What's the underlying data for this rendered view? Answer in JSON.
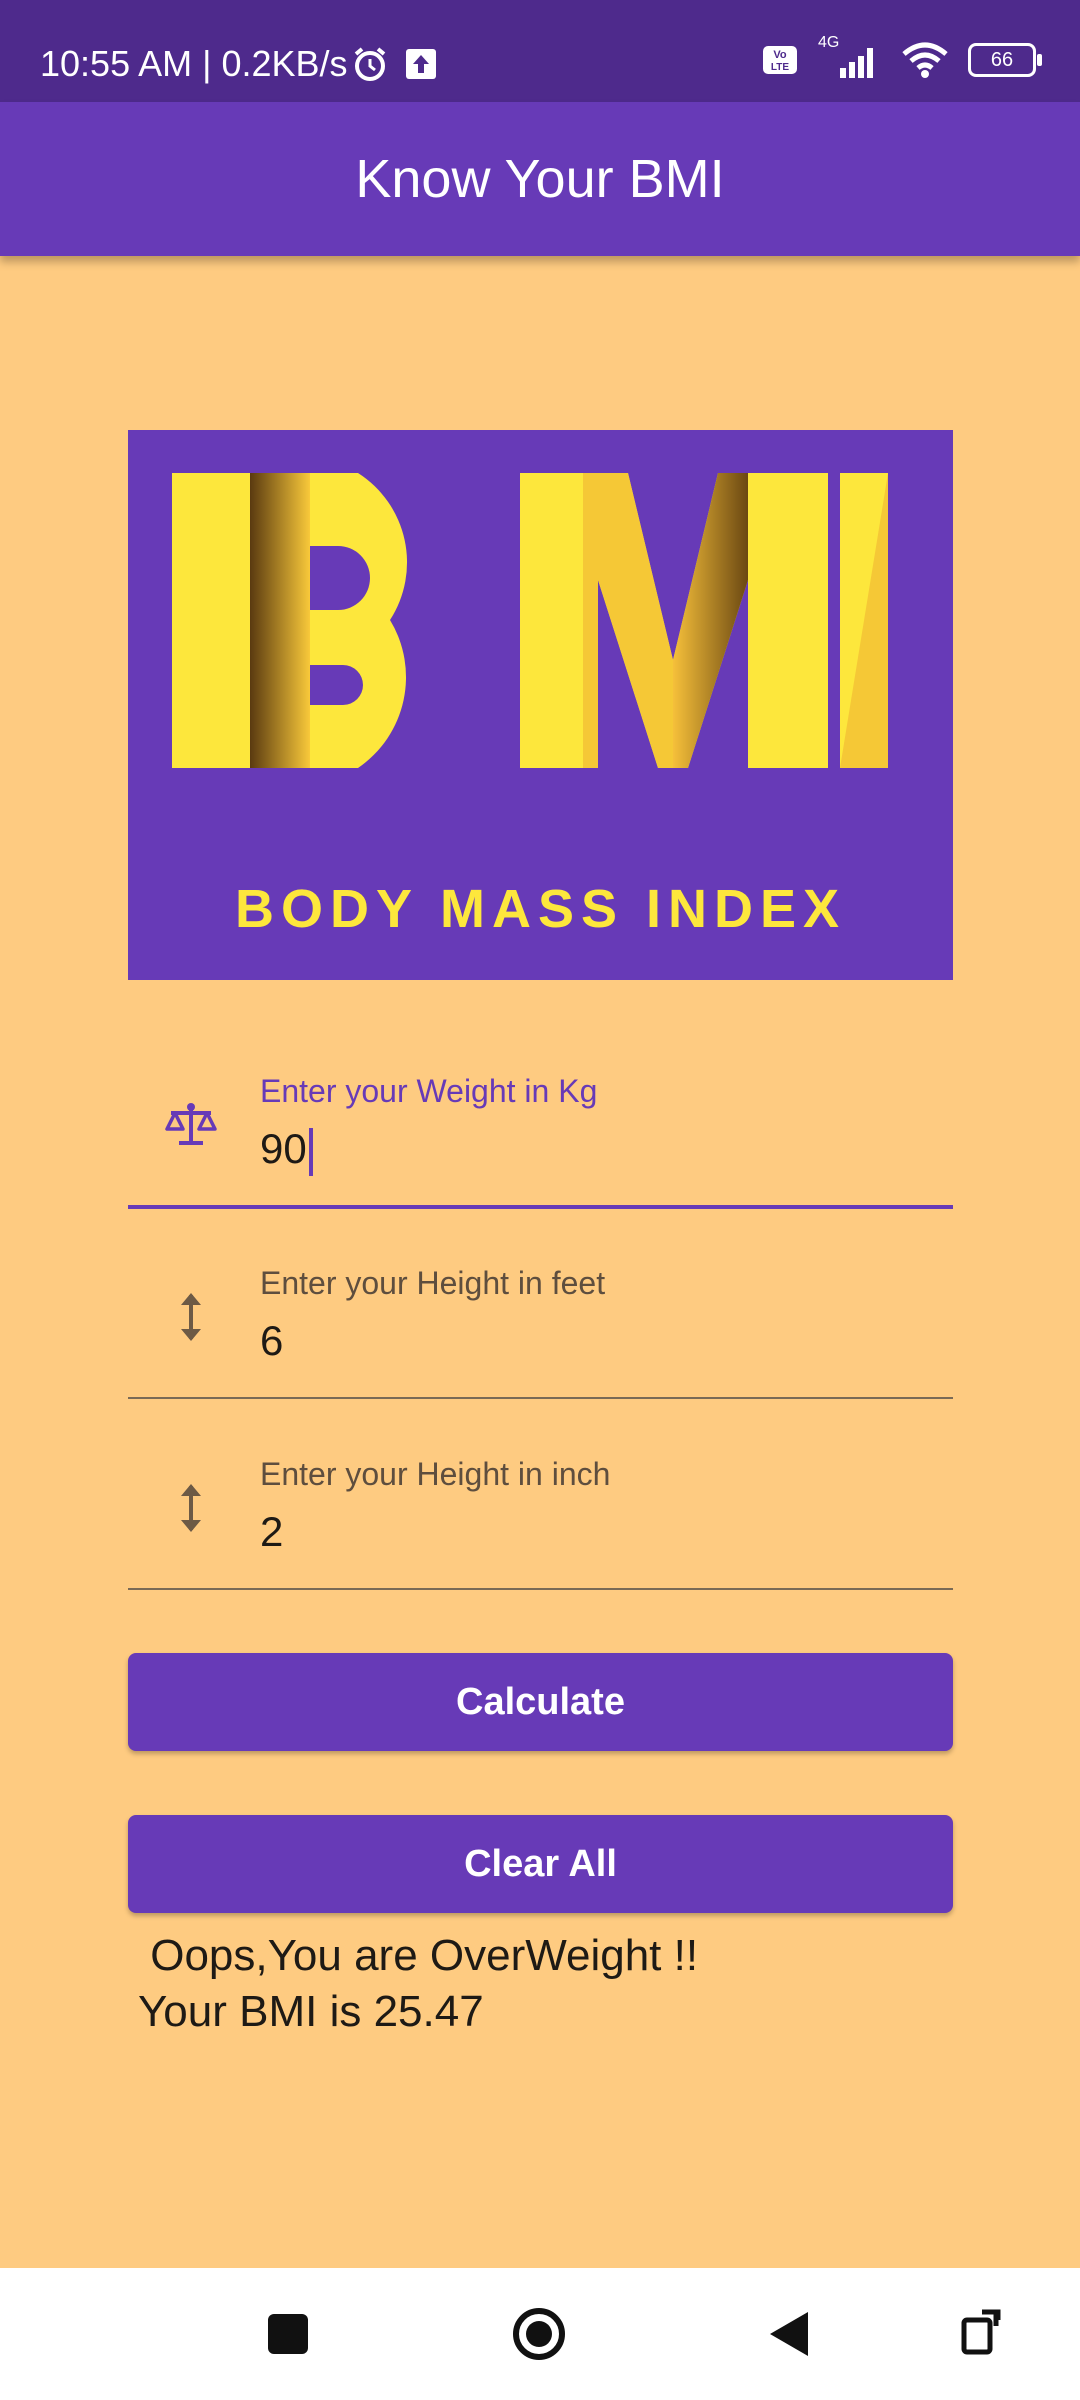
{
  "status_bar": {
    "time": "10:55 AM | 0.2KB/s",
    "network": "4G",
    "battery": "66"
  },
  "app_bar": {
    "title": "Know Your BMI"
  },
  "banner": {
    "logo_text": "BMI",
    "subtitle": "BODY MASS INDEX"
  },
  "fields": {
    "weight": {
      "label": "Enter your Weight in Kg",
      "value": "90",
      "icon": "scale-icon"
    },
    "height_feet": {
      "label": "Enter your Height in feet",
      "value": "6",
      "icon": "height-arrows-icon"
    },
    "height_inch": {
      "label": "Enter your Height in inch",
      "value": "2",
      "icon": "height-arrows-icon"
    }
  },
  "buttons": {
    "calculate": "Calculate",
    "clear": "Clear All"
  },
  "result": {
    "line1": " Oops,You are OverWeight !!",
    "line2": "Your BMI is 25.47"
  },
  "colors": {
    "primary": "#673AB7",
    "status_bar": "#4E2A8C",
    "background": "#FECB81",
    "logo_yellow": "#FDE73C"
  },
  "nav_bar": {
    "icons": [
      "recent-apps-icon",
      "home-icon",
      "back-icon",
      "rotate-icon"
    ]
  }
}
